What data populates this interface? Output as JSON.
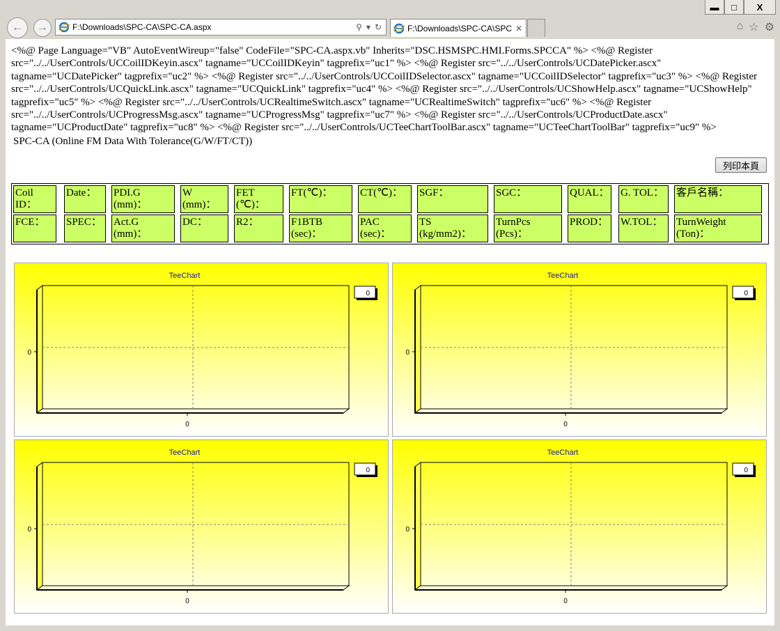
{
  "browser": {
    "address_url": "F:\\Downloads\\SPC-CA\\SPC-CA.aspx",
    "tab_title": "F:\\Downloads\\SPC-CA\\SPC...",
    "window_controls": {
      "minimize": "▬",
      "maximize": "□",
      "close": "X"
    }
  },
  "page": {
    "code_text": "<%@ Page Language=\"VB\" AutoEventWireup=\"false\" CodeFile=\"SPC-CA.aspx.vb\" Inherits=\"DSC.HSMSPC.HMI.Forms.SPCCA\" %> <%@ Register src=\"../../UserControls/UCCoilIDKeyin.ascx\" tagname=\"UCCoilIDKeyin\" tagprefix=\"uc1\" %> <%@ Register src=\"../../UserControls/UCDatePicker.ascx\" tagname=\"UCDatePicker\" tagprefix=\"uc2\" %> <%@ Register src=\"../../UserControls/UCCoilIDSelector.ascx\" tagname=\"UCCoilIDSelector\" tagprefix=\"uc3\" %> <%@ Register src=\"../../UserControls/UCQuickLink.ascx\" tagname=\"UCQuickLink\" tagprefix=\"uc4\" %> <%@ Register src=\"../../UserControls/UCShowHelp.ascx\" tagname=\"UCShowHelp\" tagprefix=\"uc5\" %> <%@ Register src=\"../../UserControls/UCRealtimeSwitch.ascx\" tagname=\"UCRealtimeSwitch\" tagprefix=\"uc6\" %> <%@ Register src=\"../../UserControls/UCProgressMsg.ascx\" tagname=\"UCProgressMsg\" tagprefix=\"uc7\" %> <%@ Register src=\"../../UserControls/UCProductDate.ascx\" tagname=\"UCProductDate\" tagprefix=\"uc8\" %> <%@ Register src=\"../../UserControls/UCTeeChartToolBar.ascx\" tagname=\"UCTeeChartToolBar\" tagprefix=\"uc9\" %>",
    "subtitle": "SPC-CA (Online FM Data With Tolerance(G/W/FT/CT))",
    "print_button": "列印本頁"
  },
  "info_table": {
    "row1": [
      "Coil ID：",
      "Date：",
      "PDI.G (mm)：",
      "W (mm)：",
      "FET (℃)：",
      "FT(℃)：",
      "CT(℃)：",
      "SGF：",
      "SGC：",
      "QUAL：",
      "G. TOL：",
      "客戶名稱："
    ],
    "row2": [
      "FCE：",
      "SPEC：",
      "Act.G (mm)：",
      "DC：",
      "R2：",
      "F1BTB (sec)：",
      "PAC (sec)：",
      "TS (kg/mm2)：",
      "TurnPcs (Pcs)：",
      "PROD：",
      "W.TOL：",
      "TurnWeight (Ton)："
    ]
  },
  "charts": [
    {
      "title": "TeeChart",
      "legend_value": "0",
      "y_tick": "0",
      "x_tick": "0"
    },
    {
      "title": "TeeChart",
      "legend_value": "0",
      "y_tick": "0",
      "x_tick": "0"
    },
    {
      "title": "TeeChart",
      "legend_value": "0",
      "y_tick": "0",
      "x_tick": "0"
    },
    {
      "title": "TeeChart",
      "legend_value": "0",
      "y_tick": "0",
      "x_tick": "0"
    }
  ],
  "colors": {
    "cell_bg": "#ccff66",
    "chart_gradient_top": "#ffff00",
    "chart_title": "#1a1aa0"
  }
}
